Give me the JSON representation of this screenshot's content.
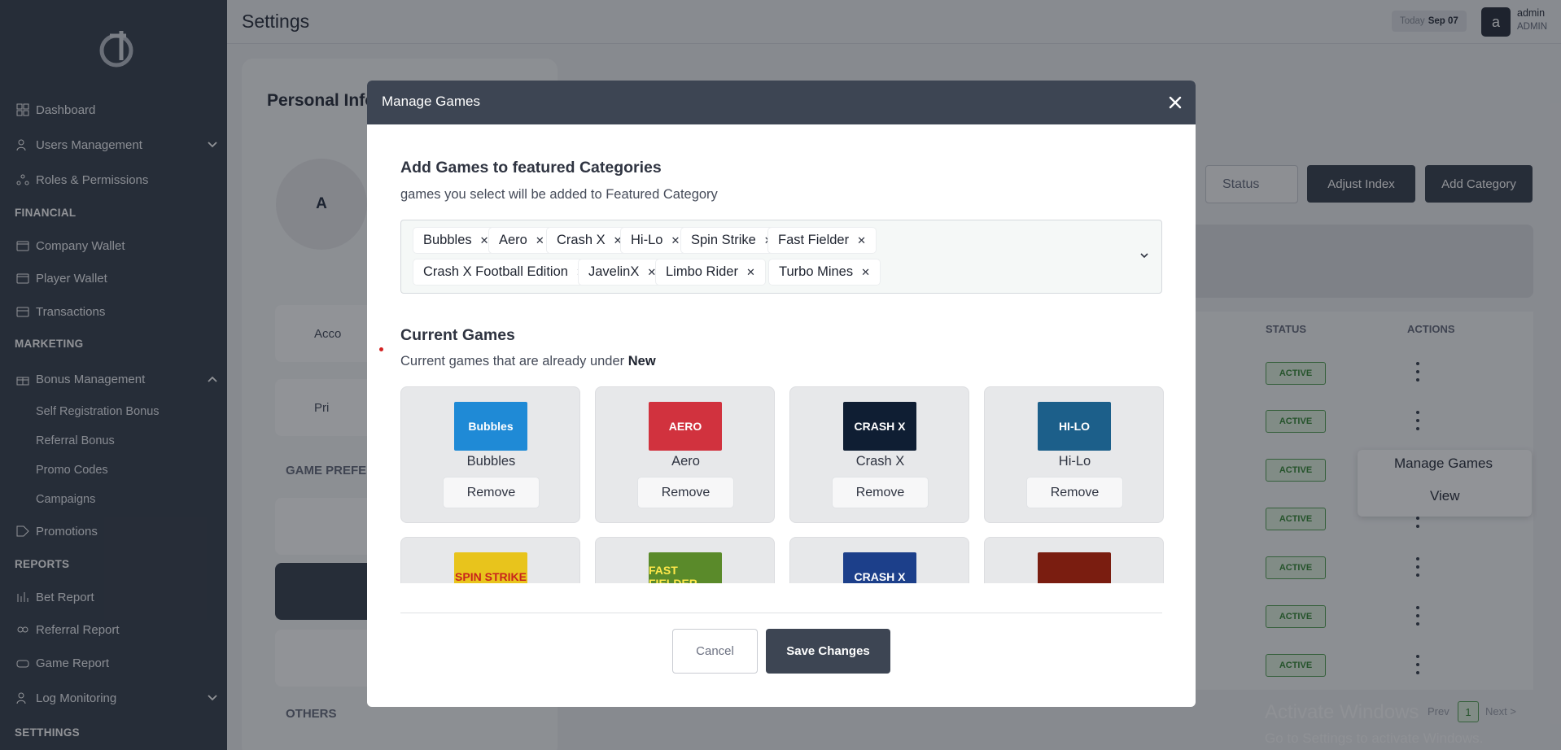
{
  "sidebar": {
    "dashboard": "Dashboard",
    "users_management": "Users Management",
    "roles_permissions": "Roles & Permissions",
    "financial": "FINANCIAL",
    "company_wallet": "Company Wallet",
    "player_wallet": "Player Wallet",
    "transactions": "Transactions",
    "marketing": "MARKETING",
    "bonus_management": "Bonus Management",
    "self_registration_bonus": "Self Registration Bonus",
    "referral_bonus": "Referral Bonus",
    "promo_codes": "Promo Codes",
    "campaigns": "Campaigns",
    "promotions": "Promotions",
    "reports": "REPORTS",
    "bet_report": "Bet Report",
    "referral_report": "Referral Report",
    "game_report": "Game Report",
    "log_monitoring": "Log Monitoring",
    "setthings": "SETTHINGS"
  },
  "header": {
    "title": "Settings",
    "today_label": "Today",
    "today_date": "Sep 07",
    "avatar_letter": "a",
    "user_name": "admin",
    "user_role": "ADMIN"
  },
  "background": {
    "personal_info": "Personal Info",
    "avatar_letter": "A",
    "account_tile": "Acco",
    "privacy_tile": "Pri",
    "game_pref": "GAME PREFER",
    "others": "OTHERS",
    "status_select": "Status",
    "adjust_index": "Adjust Index",
    "add_category": "Add Category",
    "col_status": "STATUS",
    "col_actions": "ACTIONS",
    "status_values": [
      "ACTIVE",
      "ACTIVE",
      "ACTIVE",
      "ACTIVE",
      "ACTIVE",
      "ACTIVE",
      "ACTIVE"
    ],
    "context_menu": {
      "manage_games": "Manage Games",
      "view": "View"
    },
    "pager": {
      "prev": "Prev",
      "page": "1",
      "next": "Next >"
    },
    "watermark_title": "Activate Windows",
    "watermark_sub": "Go to Settings to activate Windows."
  },
  "modal": {
    "title": "Manage Games",
    "add_heading": "Add Games to featured Categories",
    "add_sub": "games you select will be added to Featured Category",
    "selected_games": [
      "Bubbles",
      "Aero",
      "Crash X",
      "Hi-Lo",
      "Spin Strike",
      "Fast Fielder",
      "Crash X Football Edition",
      "JavelinX",
      "Limbo Rider",
      "Turbo Mines"
    ],
    "current_heading": "Current Games",
    "current_sub_prefix": "Current games that are already under",
    "current_sub_category": "New",
    "current_games": [
      {
        "name": "Bubbles",
        "thumb_text": "Bubbles",
        "color": "#1f8ad6"
      },
      {
        "name": "Aero",
        "thumb_text": "AERO",
        "color": "#d1323e"
      },
      {
        "name": "Crash X",
        "thumb_text": "CRASH X",
        "color": "#0f1e33"
      },
      {
        "name": "Hi-Lo",
        "thumb_text": "HI-LO",
        "color": "#1c5f8a"
      },
      {
        "name": "",
        "thumb_text": "SPIN STRIKE",
        "color": "#e8c41c"
      },
      {
        "name": "",
        "thumb_text": "FAST FIELDER",
        "color": "#5a8a2a"
      },
      {
        "name": "",
        "thumb_text": "CRASH X",
        "color": "#1c3f8a"
      },
      {
        "name": "",
        "thumb_text": "",
        "color": "#7a1d10"
      }
    ],
    "remove_label": "Remove",
    "cancel": "Cancel",
    "save": "Save Changes"
  }
}
